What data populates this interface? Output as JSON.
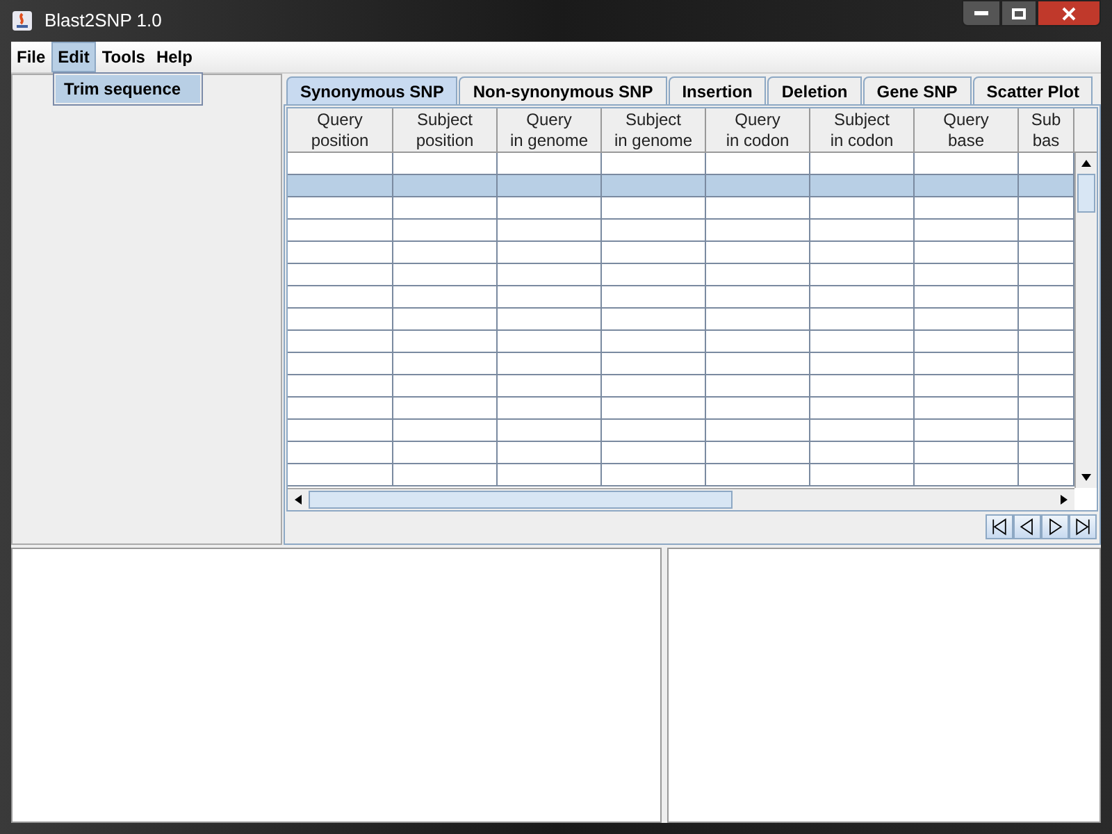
{
  "window": {
    "title": "Blast2SNP 1.0"
  },
  "menu": [
    {
      "label": "File",
      "selected": false
    },
    {
      "label": "Edit",
      "selected": true
    },
    {
      "label": "Tools",
      "selected": false
    },
    {
      "label": "Help",
      "selected": false
    }
  ],
  "dropdown": [
    {
      "label": "Trim sequence",
      "selected": true
    }
  ],
  "tabs": [
    {
      "label": "Synonymous SNP",
      "selected": true
    },
    {
      "label": "Non-synonymous SNP",
      "selected": false
    },
    {
      "label": "Insertion",
      "selected": false
    },
    {
      "label": "Deletion",
      "selected": false
    },
    {
      "label": "Gene SNP",
      "selected": false
    },
    {
      "label": "Scatter Plot",
      "selected": false
    }
  ],
  "table": {
    "columns": [
      [
        "Query",
        "position"
      ],
      [
        "Subject",
        "position"
      ],
      [
        "Query",
        "in genome"
      ],
      [
        "Subject",
        "in genome"
      ],
      [
        "Query",
        "in codon"
      ],
      [
        "Subject",
        "in codon"
      ],
      [
        "Query",
        "base"
      ],
      [
        "Sub",
        "bas"
      ]
    ],
    "rows": [
      {
        "selected": false
      },
      {
        "selected": true
      },
      {
        "selected": false
      },
      {
        "selected": false
      },
      {
        "selected": false
      },
      {
        "selected": false
      },
      {
        "selected": false
      },
      {
        "selected": false
      },
      {
        "selected": false
      },
      {
        "selected": false
      },
      {
        "selected": false
      },
      {
        "selected": false
      },
      {
        "selected": false
      },
      {
        "selected": false
      },
      {
        "selected": false
      }
    ]
  }
}
